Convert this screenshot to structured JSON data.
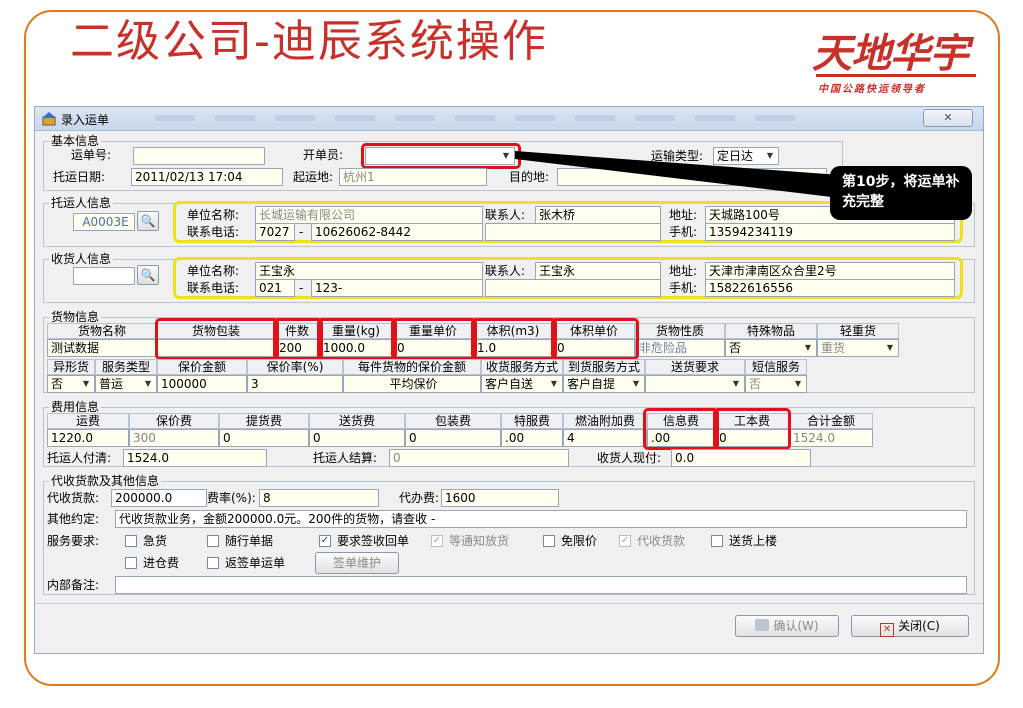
{
  "slide": {
    "title": "二级公司-迪辰系统操作",
    "logo_main": "天地华宇",
    "logo_sub": "中国公路快运领导者"
  },
  "dialog": {
    "title": "录入运单",
    "close_label": "✕"
  },
  "basic": {
    "group": "基本信息",
    "waybill_no_label": "运单号:",
    "waybill_no": "",
    "operator_label": "开单员:",
    "operator": "",
    "transport_type_label": "运输类型:",
    "transport_type": "定日达",
    "ship_date_label": "托运日期:",
    "ship_date": "2011/02/13 17:04",
    "origin_label": "起运地:",
    "origin": "杭州1",
    "destination_label": "目的地:",
    "destination": ""
  },
  "shipper": {
    "group": "托运人信息",
    "code": "A0003E",
    "company_label": "单位名称:",
    "company": "长城运输有限公司",
    "contact_label": "联系人:",
    "contact": "张木桥",
    "address_label": "地址:",
    "address": "天城路100号",
    "phone_label": "联系电话:",
    "phone_area": "7027",
    "phone_number": "10626062-8442",
    "mobile_label": "手机:",
    "mobile": "13594234119"
  },
  "consignee": {
    "group": "收货人信息",
    "code": "",
    "company_label": "单位名称:",
    "company": "王宝永",
    "contact_label": "联系人:",
    "contact": "王宝永",
    "address_label": "地址:",
    "address": "天津市津南区众合里2号",
    "phone_label": "联系电话:",
    "phone_area": "021",
    "phone_number": "123-",
    "mobile_label": "手机:",
    "mobile": "15822616556"
  },
  "goods": {
    "group": "货物信息",
    "headers": [
      "货物名称",
      "货物包装",
      "件数",
      "重量(kg)",
      "重量单价",
      "体积(m3)",
      "体积单价",
      "货物性质",
      "特殊物品",
      "轻重货"
    ],
    "values": [
      "测试数据",
      "",
      "200",
      "1000.0",
      "0",
      "1.0",
      "0",
      "非危险品",
      "否",
      "重货"
    ],
    "headers2": [
      "异形货",
      "服务类型",
      "保价金额",
      "保价率(%)",
      "每件货物的保价金额",
      "收货服务方式",
      "到货服务方式",
      "送货要求",
      "短信服务"
    ],
    "values2": [
      "否",
      "普运",
      "100000",
      "3",
      "平均保价",
      "客户自送",
      "客户自提",
      "",
      "否"
    ]
  },
  "fees": {
    "group": "费用信息",
    "headers": [
      "运费",
      "保价费",
      "提货费",
      "送货费",
      "包装费",
      "特服费",
      "燃油附加费",
      "信息费",
      "工本费",
      "合计金额"
    ],
    "values": [
      "1220.0",
      "300",
      "0",
      "0",
      "0",
      ".00",
      "4",
      ".00",
      "0",
      "1524.0"
    ],
    "shipper_pay_label": "托运人付清:",
    "shipper_pay": "1524.0",
    "shipper_settle_label": "托运人结算:",
    "shipper_settle": "0",
    "consignee_cash_label": "收货人现付:",
    "consignee_cash": "0.0"
  },
  "cod": {
    "group": "代收货款及其他信息",
    "amount_label": "代收货款:",
    "amount": "200000.0",
    "rate_label": "费率(%):",
    "rate": "8",
    "fee_label": "代办费:",
    "fee": "1600",
    "other_label": "其他约定:",
    "other": "代收货款业务，金额200000.0元。200件的货物，请查收 -",
    "service_label": "服务要求:",
    "options_row1": [
      {
        "label": "急货",
        "checked": false,
        "enabled": true
      },
      {
        "label": "随行单据",
        "checked": false,
        "enabled": true
      },
      {
        "label": "要求签收回单",
        "checked": true,
        "enabled": true
      },
      {
        "label": "等通知放货",
        "checked": true,
        "enabled": false
      },
      {
        "label": "免限价",
        "checked": false,
        "enabled": true
      },
      {
        "label": "代收货款",
        "checked": true,
        "enabled": false
      },
      {
        "label": "送货上楼",
        "checked": false,
        "enabled": true
      }
    ],
    "options_row2": [
      {
        "label": "进仓费",
        "checked": false,
        "enabled": true
      },
      {
        "label": "返签单运单",
        "checked": false,
        "enabled": true
      }
    ],
    "sign_button": "签单维护",
    "remark_label": "内部备注:",
    "remark": ""
  },
  "footer": {
    "confirm_label": "确认(W)",
    "close_label": "关闭(C)"
  },
  "annotation": {
    "callout": "第10步，将运单补充完整"
  },
  "colors": {
    "title": "#c8302a",
    "frame": "#e07a1a",
    "highlight_red": "#e2101b",
    "highlight_yellow": "#ece219",
    "callout_bg": "#000000"
  }
}
